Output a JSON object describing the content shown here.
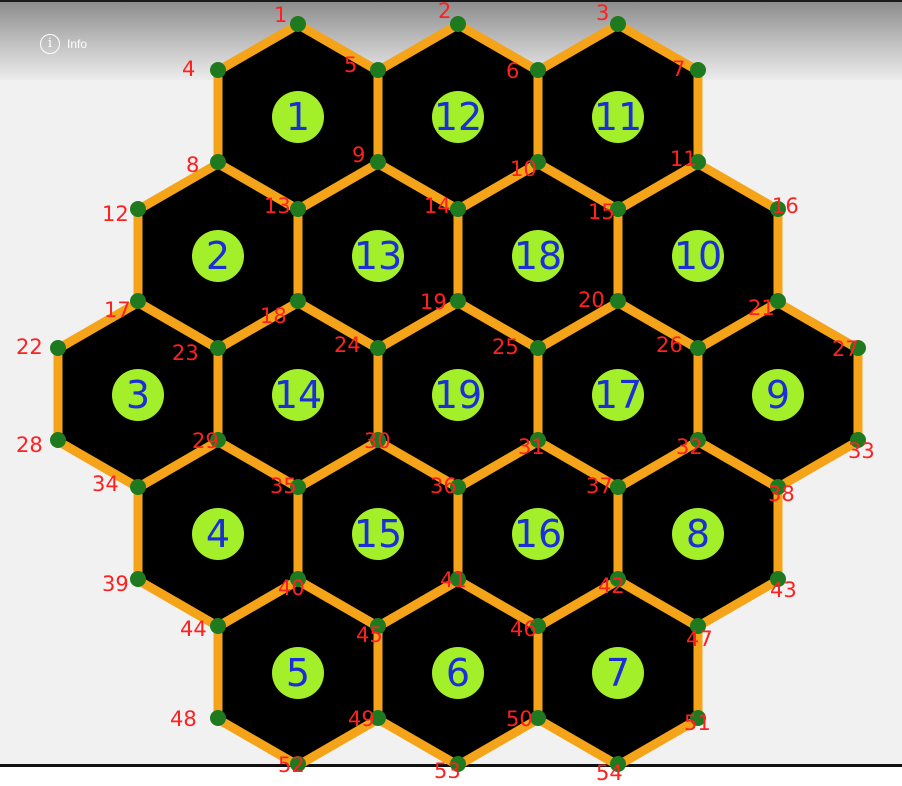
{
  "toolbar": {
    "info_label": "Info",
    "info_icon": "info-circle-icon",
    "info_glyph": "i"
  },
  "colors": {
    "background": "#f1f1f1",
    "hex_fill": "#000000",
    "hex_border": "#f5a41a",
    "token": "#a3f02a",
    "vertex": "#1f7a1f",
    "annotation_red": "#ff2a2a",
    "annotation_blue": "#1b2fd6"
  },
  "board": {
    "hex_rows": [
      3,
      4,
      5,
      4,
      3
    ],
    "tile_numbers": [
      "1",
      "12",
      "11",
      "2",
      "13",
      "18",
      "10",
      "3",
      "14",
      "19",
      "17",
      "9",
      "4",
      "15",
      "16",
      "8",
      "5",
      "6",
      "7"
    ],
    "vertex_numbers": [
      "1",
      "2",
      "3",
      "4",
      "5",
      "6",
      "7",
      "8",
      "9",
      "10",
      "11",
      "12",
      "13",
      "14",
      "15",
      "16",
      "17",
      "18",
      "19",
      "20",
      "21",
      "22",
      "23",
      "24",
      "25",
      "26",
      "27",
      "28",
      "29",
      "30",
      "31",
      "32",
      "33",
      "34",
      "35",
      "36",
      "37",
      "38",
      "39",
      "40",
      "41",
      "42",
      "43",
      "44",
      "45",
      "46",
      "47",
      "48",
      "49",
      "50",
      "51",
      "52",
      "53",
      "54"
    ]
  }
}
